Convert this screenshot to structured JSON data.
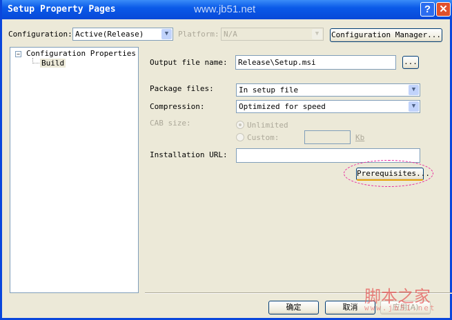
{
  "window": {
    "title": "Setup Property Pages",
    "watermark": "www.jb51.net",
    "help_label": "?",
    "close_label": "✕"
  },
  "top": {
    "configuration_label": "Configuration:",
    "configuration_value": "Active(Release)",
    "platform_label": "Platform:",
    "platform_value": "N/A",
    "config_manager_label": "Configuration Manager..."
  },
  "tree": {
    "root": "Configuration Properties",
    "expander": "−",
    "child": "Build"
  },
  "form": {
    "output_label": "Output file name:",
    "output_value": "Release\\Setup.msi",
    "browse_label": "...",
    "package_label": "Package files:",
    "package_value": "In setup file",
    "compression_label": "Compression:",
    "compression_value": "Optimized for speed",
    "cab_label": "CAB size:",
    "unlimited_label": "Unlimited",
    "custom_label": "Custom:",
    "custom_value": "",
    "kb_label": "Kb",
    "url_label": "Installation URL:",
    "url_value": "",
    "prereq_label": "Prerequisites..."
  },
  "footer": {
    "ok_label": "确定",
    "cancel_label": "取消",
    "apply_label": "应用(A)",
    "brand_watermark": "脚本之家",
    "brand_url": "www.jb51.net"
  },
  "colors": {
    "highlight_ellipse": "#e8209a",
    "title_bar": "#0a5ae8"
  }
}
